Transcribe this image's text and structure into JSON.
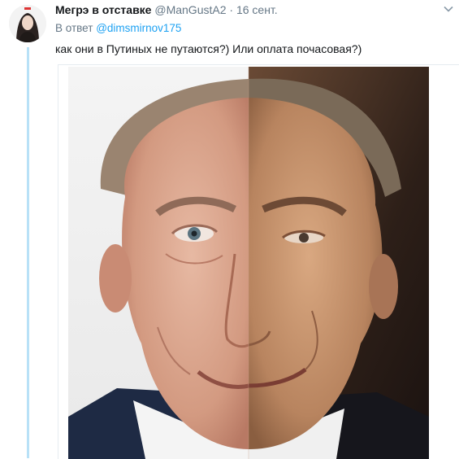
{
  "tweet": {
    "author_name": "Мегрэ в отставке",
    "author_handle": "@ManGustA2",
    "separator": "·",
    "timestamp": "16 сент.",
    "reply_prefix": "В ответ",
    "reply_mention": "@dimsmirnov175",
    "text": "как они в Путиных не путаются?) Или оплата почасовая?)"
  },
  "icons": {
    "more": "chevron-down-icon",
    "avatar": "avatar"
  },
  "colors": {
    "link": "#1da1f2",
    "muted": "#657786",
    "thread_line": "#b8e1f7"
  }
}
